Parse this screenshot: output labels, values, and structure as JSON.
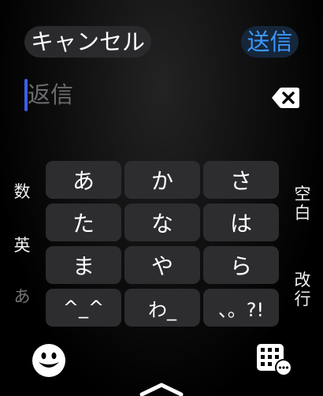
{
  "header": {
    "cancel_label": "キャンセル",
    "send_label": "送信"
  },
  "compose": {
    "placeholder": "返信"
  },
  "side_keys": {
    "numbers": "数",
    "english": "英",
    "kana": "あ",
    "space": "空\n白",
    "newline": "改\n行"
  },
  "keys": [
    "あ",
    "か",
    "さ",
    "た",
    "な",
    "は",
    "ま",
    "や",
    "ら",
    "^_^",
    "わ_",
    "、。?!"
  ],
  "colors": {
    "accent": "#3b98ff",
    "cursor": "#3f5fe6",
    "key_background": "#2d2d30"
  },
  "icons": {
    "backspace": "backspace-icon",
    "emoji": "emoji-icon",
    "keypad": "keypad-icon",
    "chevron": "chevron-up-icon"
  }
}
